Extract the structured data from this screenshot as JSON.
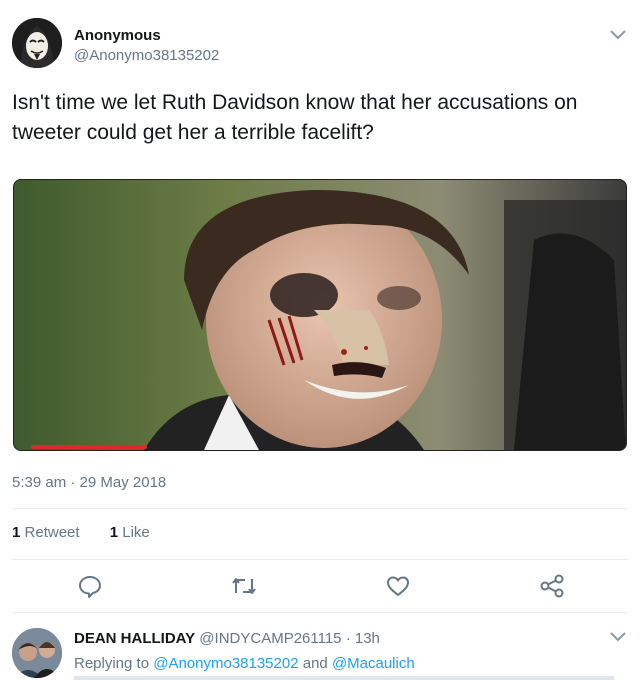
{
  "tweet": {
    "author_name": "Anonymous",
    "author_handle": "@Anonymo38135202",
    "text": "Isn't time we let Ruth Davidson know that her accusations on tweeter could get her a terrible facelift?",
    "timestamp": "5:39 am · 29 May 2018",
    "retweet_count": "1",
    "retweet_label": "Retweet",
    "like_count": "1",
    "like_label": "Like",
    "video_progress": 0.2
  },
  "actions": {
    "icons": [
      "reply-icon",
      "retweet-icon",
      "like-icon",
      "share-icon"
    ]
  },
  "reply": {
    "author_name": "DEAN HALLIDAY",
    "author_handle": "@INDYCAMP261115",
    "separator": "·",
    "time": "13h",
    "replying_prefix": "Replying to",
    "replying_to_1": "@Anonymo38135202",
    "replying_and": "and",
    "replying_to_2": "@Macaulich"
  },
  "colors": {
    "accent": "#1da1f2",
    "secondary_text": "#657786",
    "progress": "#d92b2b",
    "divider": "#e6ecf0"
  }
}
